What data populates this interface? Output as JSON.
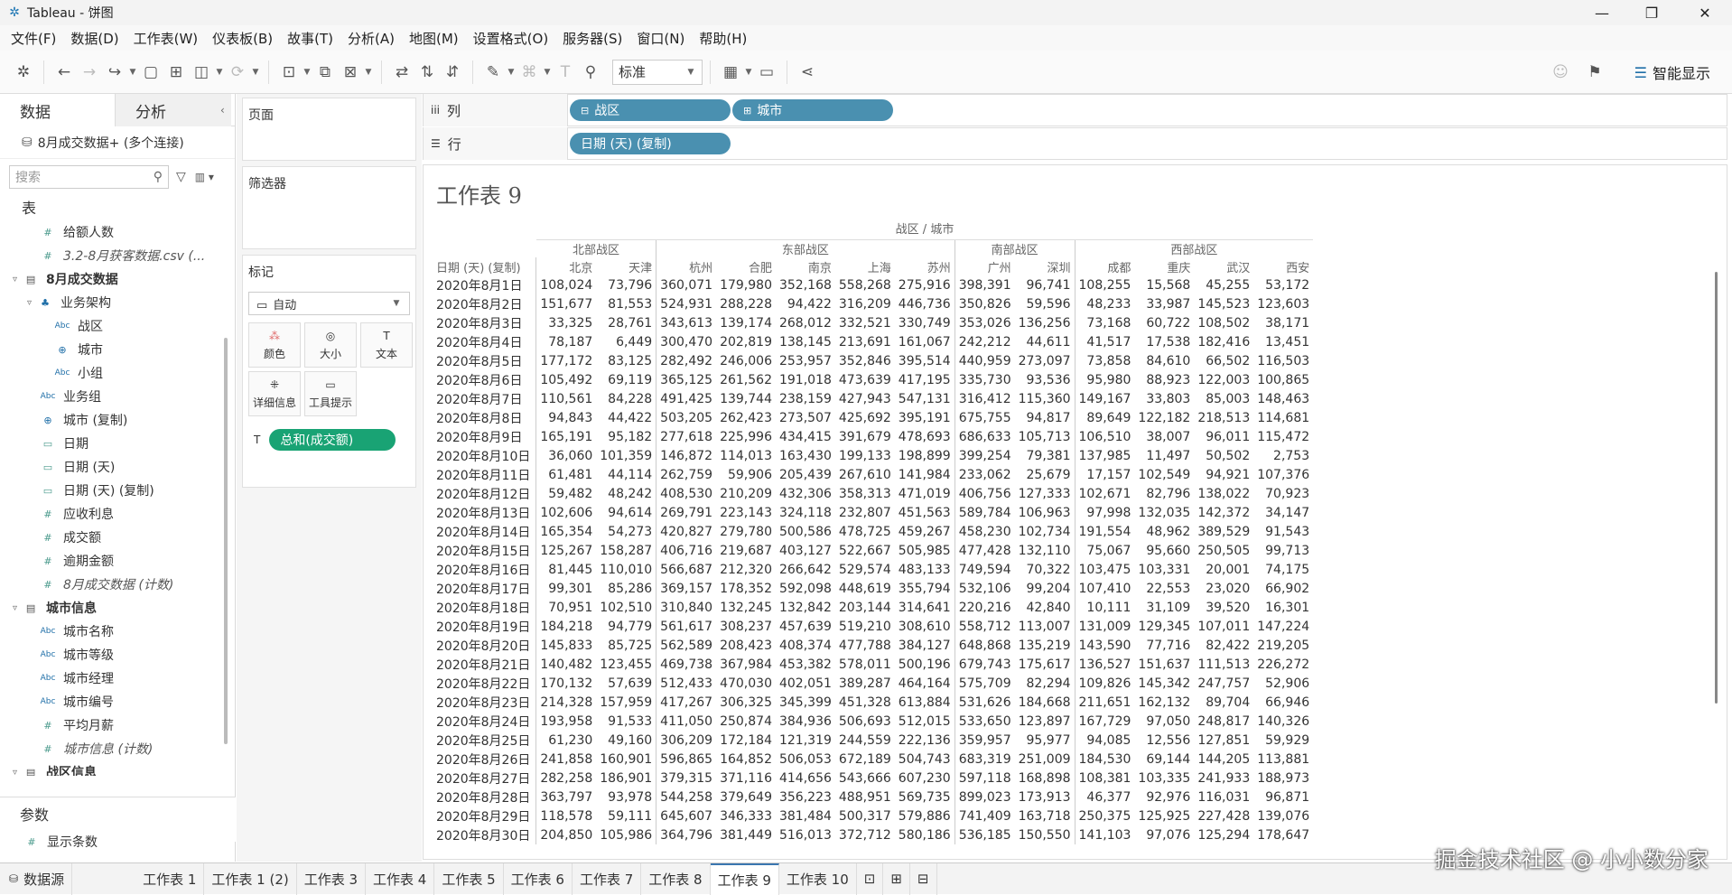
{
  "window": {
    "title": "Tableau - 饼图",
    "minimize": "—",
    "maximize": "❐",
    "close": "✕"
  },
  "menu": [
    "文件(F)",
    "数据(D)",
    "工作表(W)",
    "仪表板(B)",
    "故事(T)",
    "分析(A)",
    "地图(M)",
    "设置格式(O)",
    "服务器(S)",
    "窗口(N)",
    "帮助(H)"
  ],
  "toolbar": {
    "fit_select": "标准",
    "smart_show": "智能显示"
  },
  "left_panel": {
    "tab_data": "数据",
    "tab_analysis": "分析",
    "connection": "8月成交数据+ (多个连接)",
    "search_placeholder": "搜索",
    "tables_label": "表",
    "fields": [
      {
        "label": "给额人数",
        "icon": "#",
        "style": "measure",
        "indent": 2
      },
      {
        "label": "3.2-8月获客数据.csv (...",
        "icon": "#",
        "style": "italic",
        "indent": 2
      },
      {
        "label": "8月成交数据",
        "icon": "▤",
        "style": "group",
        "indent": 0
      },
      {
        "label": "业务架构",
        "icon": "♣",
        "style": "hier",
        "indent": 1
      },
      {
        "label": "战区",
        "icon": "Abc",
        "style": "dim",
        "indent": 3
      },
      {
        "label": "城市",
        "icon": "⊕",
        "style": "geo",
        "indent": 3
      },
      {
        "label": "小组",
        "icon": "Abc",
        "style": "dim",
        "indent": 3
      },
      {
        "label": "业务组",
        "icon": "Abc",
        "style": "dim",
        "indent": 2
      },
      {
        "label": "城市 (复制)",
        "icon": "⊕",
        "style": "geo",
        "indent": 2
      },
      {
        "label": "日期",
        "icon": "▭",
        "style": "dim",
        "indent": 2
      },
      {
        "label": "日期 (天)",
        "icon": "▭",
        "style": "measure",
        "indent": 2
      },
      {
        "label": "日期 (天) (复制)",
        "icon": "▭",
        "style": "measure",
        "indent": 2
      },
      {
        "label": "应收利息",
        "icon": "#",
        "style": "measure",
        "indent": 2
      },
      {
        "label": "成交额",
        "icon": "#",
        "style": "measure",
        "indent": 2
      },
      {
        "label": "逾期金额",
        "icon": "#",
        "style": "measure",
        "indent": 2
      },
      {
        "label": "8月成交数据 (计数)",
        "icon": "#",
        "style": "italic",
        "indent": 2
      },
      {
        "label": "城市信息",
        "icon": "▤",
        "style": "group",
        "indent": 0
      },
      {
        "label": "城市名称",
        "icon": "Abc",
        "style": "dim",
        "indent": 2
      },
      {
        "label": "城市等级",
        "icon": "Abc",
        "style": "dim",
        "indent": 2
      },
      {
        "label": "城市经理",
        "icon": "Abc",
        "style": "dim",
        "indent": 2
      },
      {
        "label": "城市编号",
        "icon": "Abc",
        "style": "dim",
        "indent": 2
      },
      {
        "label": "平均月薪",
        "icon": "#",
        "style": "measure",
        "indent": 2
      },
      {
        "label": "城市信息 (计数)",
        "icon": "#",
        "style": "italic",
        "indent": 2
      },
      {
        "label": "战区信息",
        "icon": "▤",
        "style": "group",
        "indent": 0
      }
    ],
    "params_label": "参数",
    "param_item": "显示条数"
  },
  "cards": {
    "pages": "页面",
    "filters": "筛选器",
    "marks": "标记",
    "mark_type": "自动",
    "btn_color": "颜色",
    "btn_size": "大小",
    "btn_text": "文本",
    "btn_detail": "详细信息",
    "btn_tooltip": "工具提示",
    "measure_pill": "总和(成交额)"
  },
  "shelves": {
    "columns_label": "列",
    "rows_label": "行",
    "col_pill1": "战区",
    "col_pill2": "城市",
    "row_pill": "日期 (天) (复制)"
  },
  "sheet": {
    "title": "工作表 9",
    "col_header": "战区 / 城市",
    "row_header": "日期 (天) (复制)",
    "groups": [
      {
        "name": "北部战区",
        "span": 2
      },
      {
        "name": "东部战区",
        "span": 5
      },
      {
        "name": "南部战区",
        "span": 2
      },
      {
        "name": "西部战区",
        "span": 4
      }
    ],
    "cities": [
      "北京",
      "天津",
      "杭州",
      "合肥",
      "南京",
      "上海",
      "苏州",
      "广州",
      "深圳",
      "成都",
      "重庆",
      "武汉",
      "西安"
    ],
    "rows": [
      {
        "date": "2020年8月1日",
        "v": [
          "108,024",
          "73,796",
          "360,071",
          "179,980",
          "352,168",
          "558,268",
          "275,916",
          "398,391",
          "96,741",
          "108,255",
          "15,568",
          "45,255",
          "53,172"
        ]
      },
      {
        "date": "2020年8月2日",
        "v": [
          "151,677",
          "81,553",
          "524,931",
          "288,228",
          "94,422",
          "316,209",
          "446,736",
          "350,826",
          "59,596",
          "48,233",
          "33,987",
          "145,523",
          "123,603"
        ]
      },
      {
        "date": "2020年8月3日",
        "v": [
          "33,325",
          "28,761",
          "343,613",
          "139,174",
          "268,012",
          "332,521",
          "330,749",
          "353,026",
          "136,256",
          "73,168",
          "60,722",
          "108,502",
          "38,171"
        ]
      },
      {
        "date": "2020年8月4日",
        "v": [
          "78,187",
          "6,449",
          "300,470",
          "202,819",
          "138,145",
          "213,691",
          "161,067",
          "242,212",
          "44,611",
          "41,517",
          "17,538",
          "182,416",
          "13,451"
        ]
      },
      {
        "date": "2020年8月5日",
        "v": [
          "177,172",
          "83,125",
          "282,492",
          "246,006",
          "253,957",
          "352,846",
          "395,514",
          "440,959",
          "273,097",
          "73,858",
          "84,610",
          "66,502",
          "116,503"
        ]
      },
      {
        "date": "2020年8月6日",
        "v": [
          "105,492",
          "69,119",
          "365,125",
          "261,562",
          "191,018",
          "473,639",
          "417,195",
          "335,730",
          "93,536",
          "95,980",
          "88,923",
          "122,003",
          "100,865"
        ]
      },
      {
        "date": "2020年8月7日",
        "v": [
          "110,561",
          "84,228",
          "491,425",
          "139,744",
          "238,159",
          "427,943",
          "547,131",
          "316,412",
          "115,360",
          "149,167",
          "33,803",
          "85,003",
          "148,463"
        ]
      },
      {
        "date": "2020年8月8日",
        "v": [
          "94,843",
          "44,422",
          "503,205",
          "262,423",
          "273,507",
          "425,692",
          "395,191",
          "675,755",
          "94,817",
          "89,649",
          "122,182",
          "218,513",
          "114,681"
        ]
      },
      {
        "date": "2020年8月9日",
        "v": [
          "165,191",
          "95,182",
          "277,618",
          "225,996",
          "434,415",
          "391,679",
          "478,693",
          "686,633",
          "105,713",
          "106,510",
          "38,007",
          "96,011",
          "115,472"
        ]
      },
      {
        "date": "2020年8月10日",
        "v": [
          "36,060",
          "101,359",
          "146,872",
          "114,013",
          "163,430",
          "199,133",
          "198,899",
          "399,254",
          "79,381",
          "137,985",
          "11,497",
          "50,502",
          "2,753"
        ]
      },
      {
        "date": "2020年8月11日",
        "v": [
          "61,481",
          "44,114",
          "262,759",
          "59,906",
          "205,439",
          "267,610",
          "141,984",
          "233,062",
          "25,679",
          "17,157",
          "102,549",
          "94,921",
          "107,376"
        ]
      },
      {
        "date": "2020年8月12日",
        "v": [
          "59,482",
          "48,242",
          "408,530",
          "210,209",
          "432,306",
          "358,313",
          "471,019",
          "406,756",
          "127,333",
          "102,671",
          "82,796",
          "138,022",
          "70,923"
        ]
      },
      {
        "date": "2020年8月13日",
        "v": [
          "102,606",
          "94,614",
          "269,791",
          "223,143",
          "324,118",
          "232,807",
          "451,563",
          "589,784",
          "106,963",
          "97,998",
          "132,035",
          "142,372",
          "34,147"
        ]
      },
      {
        "date": "2020年8月14日",
        "v": [
          "165,354",
          "54,273",
          "420,827",
          "279,780",
          "500,586",
          "478,725",
          "459,267",
          "458,230",
          "102,734",
          "191,554",
          "48,962",
          "389,529",
          "91,543"
        ]
      },
      {
        "date": "2020年8月15日",
        "v": [
          "125,267",
          "158,287",
          "406,716",
          "219,687",
          "403,127",
          "522,667",
          "505,985",
          "477,428",
          "132,110",
          "75,067",
          "95,660",
          "250,505",
          "99,713"
        ]
      },
      {
        "date": "2020年8月16日",
        "v": [
          "81,445",
          "110,010",
          "566,687",
          "212,320",
          "266,642",
          "529,574",
          "483,133",
          "749,594",
          "70,322",
          "103,475",
          "103,331",
          "20,001",
          "74,175"
        ]
      },
      {
        "date": "2020年8月17日",
        "v": [
          "99,301",
          "85,286",
          "369,157",
          "178,352",
          "592,098",
          "448,619",
          "355,794",
          "532,106",
          "99,204",
          "107,410",
          "22,553",
          "23,020",
          "66,902"
        ]
      },
      {
        "date": "2020年8月18日",
        "v": [
          "70,951",
          "102,510",
          "310,840",
          "132,245",
          "132,842",
          "203,144",
          "314,641",
          "220,216",
          "42,840",
          "10,111",
          "31,109",
          "39,520",
          "16,301"
        ]
      },
      {
        "date": "2020年8月19日",
        "v": [
          "184,218",
          "94,779",
          "561,617",
          "308,237",
          "457,639",
          "519,210",
          "308,610",
          "558,712",
          "113,007",
          "131,009",
          "129,345",
          "107,011",
          "147,224"
        ]
      },
      {
        "date": "2020年8月20日",
        "v": [
          "145,833",
          "85,725",
          "562,589",
          "208,423",
          "408,374",
          "477,788",
          "384,127",
          "648,868",
          "135,219",
          "143,590",
          "77,716",
          "82,422",
          "219,205"
        ]
      },
      {
        "date": "2020年8月21日",
        "v": [
          "140,482",
          "123,455",
          "469,738",
          "367,984",
          "453,382",
          "578,011",
          "500,196",
          "679,743",
          "175,617",
          "136,527",
          "151,637",
          "111,513",
          "226,272"
        ]
      },
      {
        "date": "2020年8月22日",
        "v": [
          "170,132",
          "57,639",
          "512,433",
          "470,030",
          "402,051",
          "389,287",
          "464,164",
          "575,709",
          "82,294",
          "109,826",
          "145,342",
          "247,757",
          "52,906"
        ]
      },
      {
        "date": "2020年8月23日",
        "v": [
          "214,328",
          "157,959",
          "417,267",
          "306,325",
          "345,399",
          "451,328",
          "613,884",
          "531,626",
          "184,668",
          "211,651",
          "162,132",
          "89,704",
          "66,946"
        ]
      },
      {
        "date": "2020年8月24日",
        "v": [
          "193,958",
          "91,533",
          "411,050",
          "250,874",
          "384,936",
          "506,693",
          "512,015",
          "533,650",
          "123,897",
          "167,729",
          "97,050",
          "248,817",
          "140,326"
        ]
      },
      {
        "date": "2020年8月25日",
        "v": [
          "61,230",
          "49,160",
          "306,209",
          "172,184",
          "121,319",
          "244,559",
          "222,136",
          "359,957",
          "95,977",
          "94,085",
          "12,556",
          "127,851",
          "59,929"
        ]
      },
      {
        "date": "2020年8月26日",
        "v": [
          "241,858",
          "160,901",
          "596,865",
          "164,852",
          "506,053",
          "672,189",
          "504,743",
          "683,319",
          "251,009",
          "184,530",
          "69,144",
          "144,205",
          "113,881"
        ]
      },
      {
        "date": "2020年8月27日",
        "v": [
          "282,258",
          "186,901",
          "379,315",
          "371,116",
          "414,656",
          "543,666",
          "607,230",
          "597,118",
          "168,898",
          "108,381",
          "103,335",
          "241,933",
          "188,973"
        ]
      },
      {
        "date": "2020年8月28日",
        "v": [
          "363,797",
          "93,978",
          "544,258",
          "379,649",
          "356,223",
          "488,951",
          "569,735",
          "899,023",
          "173,913",
          "46,377",
          "92,976",
          "116,031",
          "96,871"
        ]
      },
      {
        "date": "2020年8月29日",
        "v": [
          "118,578",
          "59,111",
          "645,607",
          "346,333",
          "381,484",
          "500,317",
          "579,886",
          "741,409",
          "163,718",
          "250,375",
          "125,925",
          "227,428",
          "139,076"
        ]
      },
      {
        "date": "2020年8月30日",
        "v": [
          "204,850",
          "105,986",
          "364,796",
          "381,449",
          "516,013",
          "372,712",
          "580,186",
          "536,185",
          "150,550",
          "141,103",
          "97,076",
          "125,294",
          "178,647"
        ]
      }
    ]
  },
  "bottom": {
    "datasource": "数据源",
    "tabs": [
      "工作表 1",
      "工作表 1 (2)",
      "工作表 3",
      "工作表 4",
      "工作表 5",
      "工作表 6",
      "工作表 7",
      "工作表 8",
      "工作表 9",
      "工作表 10"
    ],
    "active_tab": "工作表 9"
  },
  "watermark": "掘金技术社区 @ 小小数分家"
}
